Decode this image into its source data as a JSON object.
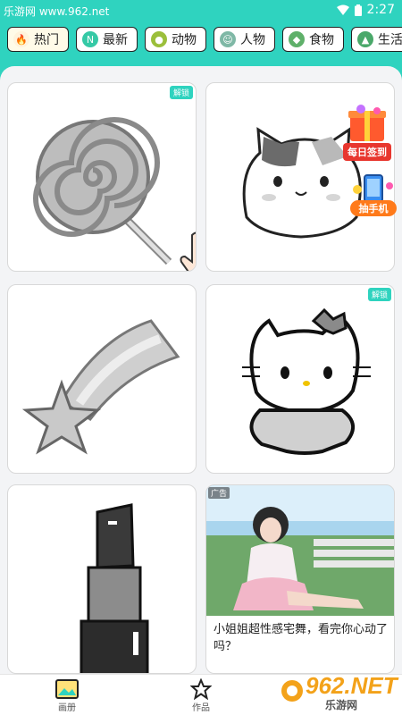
{
  "status": {
    "site": "乐游网 www.962.net",
    "time": "2:27"
  },
  "tabs": [
    {
      "label": "热门",
      "icon": "flame-icon",
      "color": "#f08a24"
    },
    {
      "label": "最新",
      "icon": "new-icon",
      "color": "#35c9a6"
    },
    {
      "label": "动物",
      "icon": "animal-icon",
      "color": "#9bbf3b"
    },
    {
      "label": "人物",
      "icon": "person-icon",
      "color": "#7fb8a6"
    },
    {
      "label": "食物",
      "icon": "food-icon",
      "color": "#5fb06a"
    },
    {
      "label": "生活",
      "icon": "life-icon",
      "color": "#4aa86a"
    }
  ],
  "cards": [
    {
      "name": "lollipop",
      "badge": "解锁"
    },
    {
      "name": "cat",
      "badge": ""
    },
    {
      "name": "shooting-star",
      "badge": ""
    },
    {
      "name": "hello-kitty",
      "badge": "解锁"
    },
    {
      "name": "lipstick",
      "badge": ""
    }
  ],
  "ad": {
    "tag": "广告",
    "text": "小姐姐超性感宅舞，看完你心动了吗？"
  },
  "floats": {
    "sign_in": "每日签到",
    "grab_phone": "抽手机"
  },
  "nav": [
    {
      "label": "画册"
    },
    {
      "label": "作品"
    }
  ],
  "watermark": {
    "brand": "962.NET",
    "sub": "乐游网"
  },
  "colors": {
    "accent": "#2fd3bf",
    "background": "#f3f4f6"
  }
}
